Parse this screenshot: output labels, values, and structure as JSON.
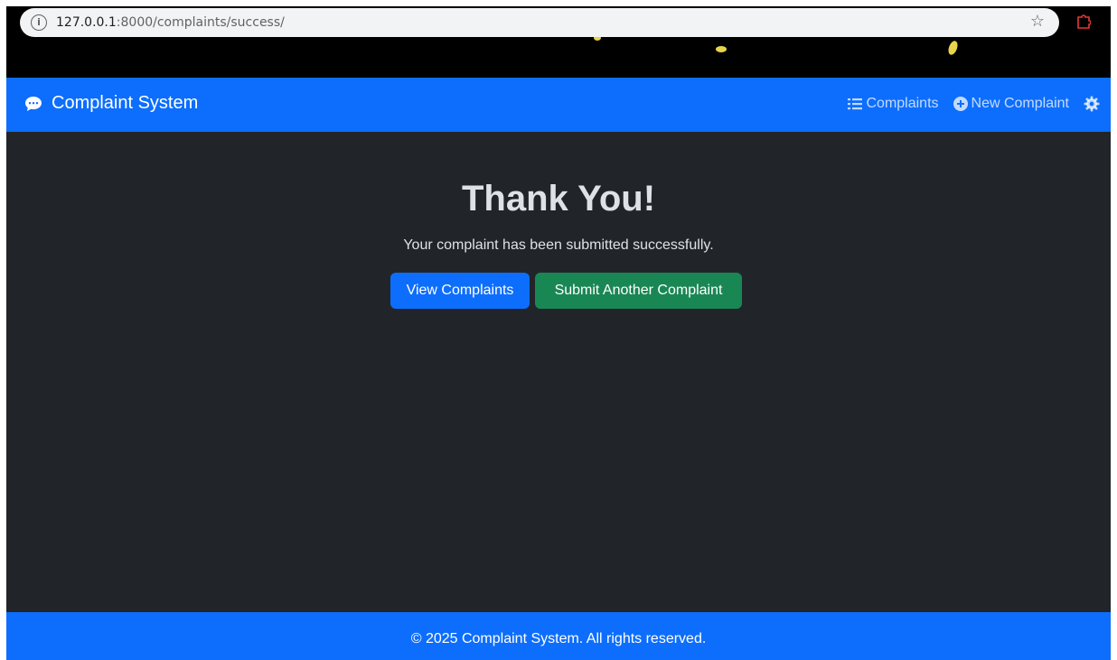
{
  "browser": {
    "url_host": "127.0.0.1",
    "url_rest": ":8000/complaints/success/"
  },
  "navbar": {
    "brand": "Complaint System",
    "links": [
      {
        "label": "Complaints",
        "icon": "list-icon"
      },
      {
        "label": "New Complaint",
        "icon": "plus-circle-icon"
      }
    ],
    "settings_icon": "gear-icon"
  },
  "main": {
    "title": "Thank You!",
    "message": "Your complaint has been submitted successfully.",
    "view_button": "View Complaints",
    "submit_button": "Submit Another Complaint"
  },
  "footer": {
    "text": "© 2025 Complaint System. All rights reserved."
  },
  "colors": {
    "primary": "#0d6efd",
    "success": "#198754",
    "background": "#212529",
    "text": "#dee2e6"
  }
}
